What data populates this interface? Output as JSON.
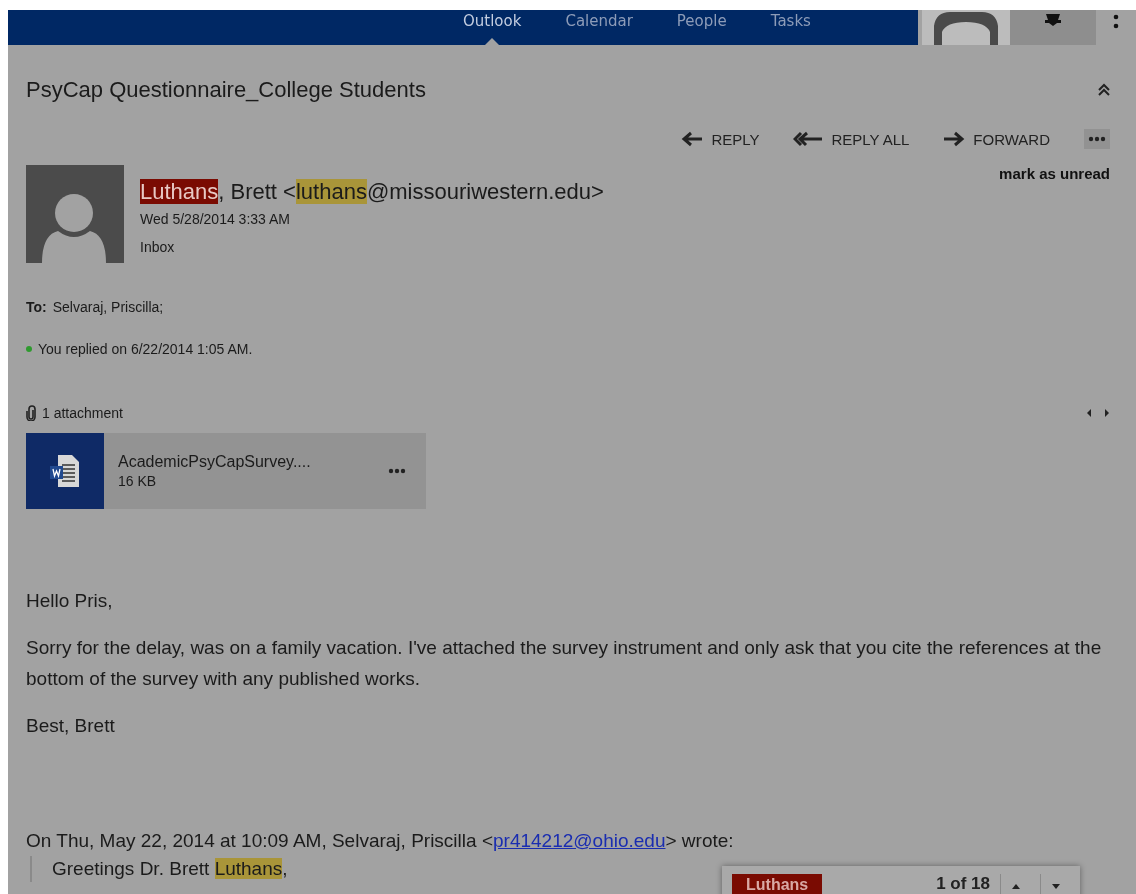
{
  "nav": {
    "tabs": [
      {
        "label": "Outlook",
        "selected": true
      },
      {
        "label": "Calendar",
        "selected": false
      },
      {
        "label": "People",
        "selected": false
      },
      {
        "label": "Tasks",
        "selected": false
      }
    ]
  },
  "message": {
    "title": "PsyCap Questionnaire_College Students",
    "actions": [
      {
        "kind": "reply",
        "label": "REPLY"
      },
      {
        "kind": "reply_all",
        "label": "REPLY ALL"
      },
      {
        "kind": "forward",
        "label": "FORWARD"
      }
    ],
    "mark_unread": "mark as unread",
    "sender": [
      {
        "text": "Luthans",
        "color": "#7a0b02",
        "selected": true
      },
      {
        "text": ", Brett <"
      },
      {
        "text": "luthans",
        "color": "#a99539",
        "selected": false
      },
      {
        "text": "@missouriwestern.edu>"
      }
    ],
    "date": "Wed 5/28/2014 3:33 AM",
    "folder": "Inbox",
    "to_label": "To:",
    "to": "Selvaraj, Priscilla;",
    "replied": "You replied on 6/22/2014 1:05 AM.",
    "attachments_heading": "1 attachment",
    "attachment": {
      "name": "AcademicPsyCapSurvey....",
      "size": "16 KB"
    },
    "body": [
      "Hello Pris,",
      "Sorry for the delay, was on a family vacation.  I've attached the survey instrument and only ask that you cite the references at the bottom of the survey with any published works.",
      "Best, Brett"
    ],
    "quote_header": [
      {
        "text": "On Thu, May 22, 2014 at 10:09 AM, Selvaraj, Priscilla <",
        "kind": "text"
      },
      {
        "text": "pr414212@ohio.edu",
        "kind": "link"
      },
      {
        "text": "> wrote:",
        "kind": "text"
      }
    ],
    "quote": [
      {
        "text": "Greetings Dr. Brett "
      },
      {
        "text": "Luthans",
        "color": "#a99539",
        "selected": false
      },
      {
        "text": ","
      }
    ]
  },
  "find": {
    "term": "Luthans",
    "count": "1 of 18"
  }
}
